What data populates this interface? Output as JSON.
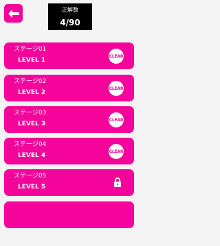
{
  "header": {
    "back_icon": "arrow-left-icon",
    "score_label": "正解数",
    "score_value": "4/90"
  },
  "stages": [
    {
      "name": "ステージ01",
      "level": "LEVEL 1",
      "status": "CLEAR"
    },
    {
      "name": "ステージ02",
      "level": "LEVEL 2",
      "status": "CLEAR"
    },
    {
      "name": "ステージ03",
      "level": "LEVEL 3",
      "status": "CLEAR"
    },
    {
      "name": "ステージ04",
      "level": "LEVEL 4",
      "status": "CLEAR"
    },
    {
      "name": "ステージ05",
      "level": "LEVEL 5",
      "status_icon": "lock-icon"
    }
  ],
  "colors": {
    "accent": "#f5049b",
    "background": "#f4f4f4",
    "score_box": "#000000",
    "text_on_accent": "#ffffff"
  }
}
